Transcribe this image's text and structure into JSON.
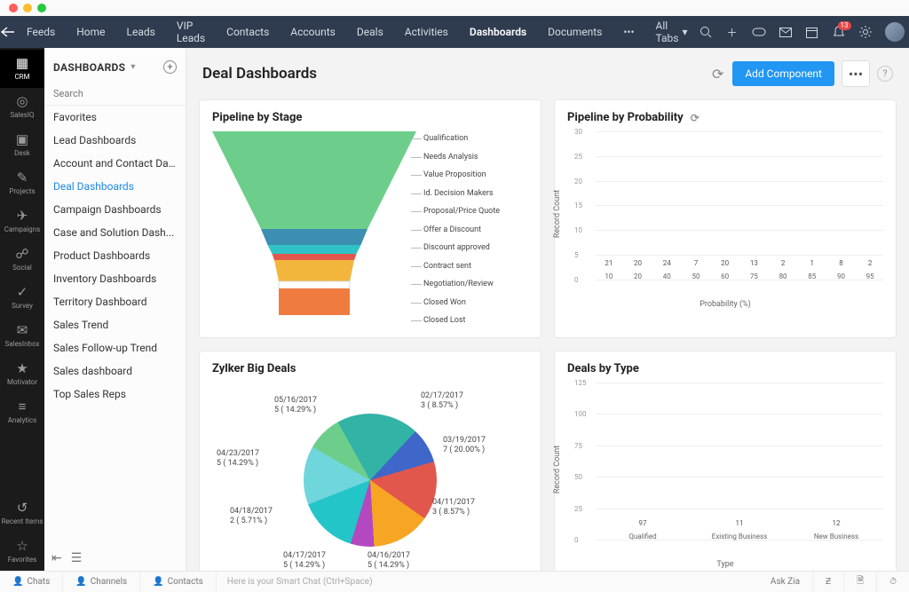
{
  "topnav": {
    "items": [
      "Feeds",
      "Home",
      "Leads",
      "VIP Leads",
      "Contacts",
      "Accounts",
      "Deals",
      "Activities",
      "Dashboards",
      "Documents"
    ],
    "active_index": 8,
    "all_tabs": "All Tabs",
    "icons": [
      "search",
      "plus",
      "gamepad",
      "mail",
      "calendar",
      "bell",
      "gear"
    ],
    "bell_badge": "13"
  },
  "rail": {
    "items": [
      {
        "label": "CRM",
        "icon": "▦"
      },
      {
        "label": "SalesIQ",
        "icon": "◎"
      },
      {
        "label": "Desk",
        "icon": "▣"
      },
      {
        "label": "Projects",
        "icon": "✎"
      },
      {
        "label": "Campaigns",
        "icon": "✈"
      },
      {
        "label": "Social",
        "icon": "☍"
      },
      {
        "label": "Survey",
        "icon": "✓"
      },
      {
        "label": "SalesInbox",
        "icon": "✉"
      },
      {
        "label": "Motivator",
        "icon": "★"
      },
      {
        "label": "Analytics",
        "icon": "≡"
      }
    ],
    "active_index": 0,
    "bottom": [
      {
        "label": "Recent Items",
        "icon": "↺"
      },
      {
        "label": "Favorites",
        "icon": "☆"
      }
    ]
  },
  "sidebar": {
    "title": "DASHBOARDS",
    "search_placeholder": "Search",
    "items": [
      "Favorites",
      "Lead Dashboards",
      "Account and Contact Da...",
      "Deal Dashboards",
      "Campaign Dashboards",
      "Case and Solution Dash...",
      "Product Dashboards",
      "Inventory Dashboards",
      "Territory Dashboard",
      "Sales Trend",
      "Sales Follow-up Trend",
      "Sales dashboard",
      "Top Sales Reps"
    ],
    "active_index": 3
  },
  "page": {
    "title": "Deal Dashboards",
    "add_component": "Add Component"
  },
  "cards": {
    "pipeline_stage_title": "Pipeline by Stage",
    "pipeline_prob_title": "Pipeline by Probability",
    "big_deals_title": "Zylker Big Deals",
    "deals_type_title": "Deals by Type"
  },
  "chart_data": {
    "pipeline_stage": {
      "type": "funnel",
      "stages": [
        {
          "label": "Qualification",
          "color": "#6cce8a"
        },
        {
          "label": "Needs Analysis",
          "color": "#6cce8a"
        },
        {
          "label": "Value Proposition",
          "color": "#6cce8a"
        },
        {
          "label": "Id. Decision Makers",
          "color": "#6cce8a"
        },
        {
          "label": "Proposal/Price Quote",
          "color": "#3c8fb0"
        },
        {
          "label": "Offer a Discount",
          "color": "#2fc3c7"
        },
        {
          "label": "Discount approved",
          "color": "#e2574c"
        },
        {
          "label": "Contract sent",
          "color": "#f3b63c"
        },
        {
          "label": "Negotiation/Review",
          "color": "#f3b63c"
        },
        {
          "label": "Closed Won",
          "color": "#ffffff"
        },
        {
          "label": "Closed Lost",
          "color": "#f07b3f"
        }
      ]
    },
    "pipeline_prob": {
      "type": "bar",
      "xlabel": "Probability (%)",
      "ylabel": "Record Count",
      "ylim": [
        0,
        30
      ],
      "yticks": [
        0,
        5,
        10,
        15,
        20,
        25,
        30
      ],
      "categories": [
        "10",
        "20",
        "40",
        "50",
        "60",
        "75",
        "80",
        "85",
        "90",
        "95"
      ],
      "values": [
        21,
        20,
        24,
        7,
        20,
        13,
        2,
        1,
        8,
        2
      ],
      "colors": [
        "#2aa7d9",
        "#3f66c9",
        "#f6a623",
        "#24c5c8",
        "#4dd0d3",
        "#24c5c8",
        "#f6a623",
        "#f6a623",
        "#b348c0",
        "#f6a623"
      ]
    },
    "big_deals": {
      "type": "pie",
      "slices": [
        {
          "label": "02/17/2017",
          "count": 3,
          "pct": 8.57,
          "color": "#6cce8a"
        },
        {
          "label": "03/19/2017",
          "count": 7,
          "pct": 20.0,
          "color": "#33b3a6"
        },
        {
          "label": "04/11/2017",
          "count": 3,
          "pct": 8.57,
          "color": "#3f66c9"
        },
        {
          "label": "04/16/2017",
          "count": 5,
          "pct": 14.29,
          "color": "#e2574c"
        },
        {
          "label": "04/17/2017",
          "count": 5,
          "pct": 14.29,
          "color": "#f6a623"
        },
        {
          "label": "04/18/2017",
          "count": 2,
          "pct": 5.71,
          "color": "#b348c0"
        },
        {
          "label": "04/23/2017",
          "count": 5,
          "pct": 14.29,
          "color": "#24c5c8"
        },
        {
          "label": "05/16/2017",
          "count": 5,
          "pct": 14.29,
          "color": "#6fd6db"
        }
      ]
    },
    "deals_type": {
      "type": "bar",
      "xlabel": "Type",
      "ylabel": "Record Count",
      "ylim": [
        0,
        125
      ],
      "yticks": [
        0,
        25,
        50,
        75,
        100,
        125
      ],
      "categories": [
        "Qualified",
        "Existing Business",
        "New Business"
      ],
      "values": [
        97,
        11,
        12
      ],
      "colors": [
        "#6cce8a",
        "#f6a623",
        "#2aa7d9"
      ]
    }
  },
  "statusbar": {
    "segments": [
      "Chats",
      "Channels",
      "Contacts"
    ],
    "smartchat": "Here is your Smart Chat (Ctrl+Space)",
    "askzia": "Ask Zia"
  }
}
